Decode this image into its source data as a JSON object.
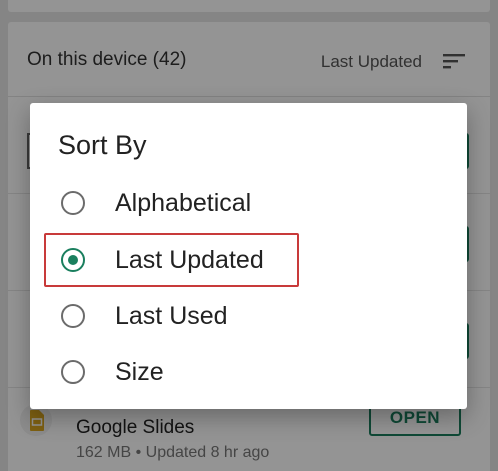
{
  "background": {
    "section_title": "On this device (42)",
    "sort_label": "Last Updated",
    "sort_icon": "sort-icon",
    "app": {
      "name": "Google Slides",
      "meta": "162 MB • Updated 8 hr ago",
      "icon": "google-slides-icon",
      "open_label": "OPEN"
    }
  },
  "dialog": {
    "title": "Sort By",
    "options": [
      {
        "label": "Alphabetical",
        "selected": false
      },
      {
        "label": "Last Updated",
        "selected": true
      },
      {
        "label": "Last Used",
        "selected": false
      },
      {
        "label": "Size",
        "selected": false
      }
    ],
    "highlighted_option": "Last Updated"
  },
  "colors": {
    "accent": "#1a7f5e",
    "highlight": "#c83a3a"
  }
}
